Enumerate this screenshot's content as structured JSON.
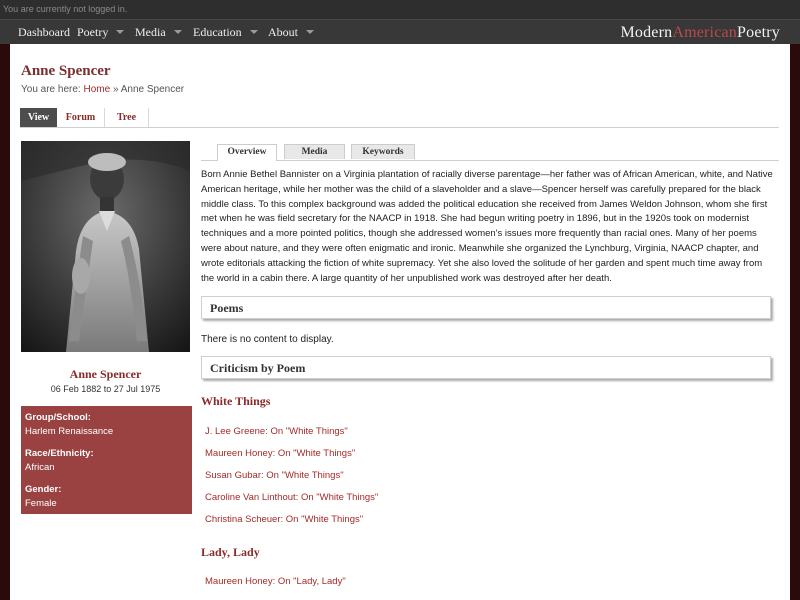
{
  "userbar": {
    "text": "You are currently not logged in."
  },
  "nav": {
    "items": [
      {
        "label": "Dashboard",
        "dropdown": false
      },
      {
        "label": "Poetry",
        "dropdown": true
      },
      {
        "label": "Media",
        "dropdown": true
      },
      {
        "label": "Education",
        "dropdown": true
      },
      {
        "label": "About",
        "dropdown": true
      }
    ],
    "logo": {
      "part1": "Modern",
      "part2": "American",
      "part3": "Poetry"
    }
  },
  "page": {
    "title": "Anne Spencer",
    "breadcrumb": {
      "prefix": "You are here:",
      "home": "Home",
      "separator": "»",
      "current": "Anne Spencer"
    },
    "view_tabs": [
      "View",
      "Forum",
      "Tree"
    ]
  },
  "sidebar": {
    "portrait_alt": "Anne Spencer",
    "name": "Anne Spencer",
    "dates": "06 Feb 1882 to 27 Jul 1975",
    "info": [
      {
        "label": "Group/School:",
        "value": "Harlem Renaissance"
      },
      {
        "label": "Race/Ethnicity:",
        "value": "African"
      },
      {
        "label": "Gender:",
        "value": "Female"
      }
    ]
  },
  "content": {
    "tabs": [
      "Overview",
      "Media",
      "Keywords"
    ],
    "bio": "Born Annie Bethel Bannister on a Virginia plantation of racially diverse parentage—her father was of African American, white, and Native American heritage, while her mother was the child of a slaveholder and a slave—Spencer herself was carefully prepared for the black middle class. To this complex background was added the political education she received from James Weldon Johnson, whom she first met when he was field secretary for the NAACP in 1918. She had begun writing poetry in 1896, but in the 1920s took on modernist techniques and a more pointed politics, though she addressed women's issues more frequently than racial ones. Many of her poems were about nature, and they were often enigmatic and ironic. Meanwhile she organized the Lynchburg, Virginia, NAACP chapter, and wrote editorials attacking the fiction of white supremacy. Yet she also loved the solitude of her garden and spent much time away from the world in a cabin there. A large quantity of her unpublished work was destroyed after her death.",
    "poems_heading": "Poems",
    "poems_empty": "There is no content to display.",
    "criticism_heading": "Criticism by Poem",
    "criticism": [
      {
        "poem": "White Things",
        "links": [
          "J. Lee Greene: On \"White Things\"",
          "Maureen Honey: On \"White Things\"",
          "Susan Gubar: On \"White Things\"",
          "Caroline Van Linthout: On \"White Things\"",
          "Christina Scheuer: On \"White Things\""
        ]
      },
      {
        "poem": "Lady, Lady",
        "links": [
          "Maureen Honey: On \"Lady, Lady\""
        ]
      }
    ]
  },
  "colors": {
    "accent": "#8a2b2b",
    "link": "#a52a2a",
    "info_box": "#9a4242",
    "nav_bg": "#383838",
    "page_bg": "#2a0a0a"
  }
}
